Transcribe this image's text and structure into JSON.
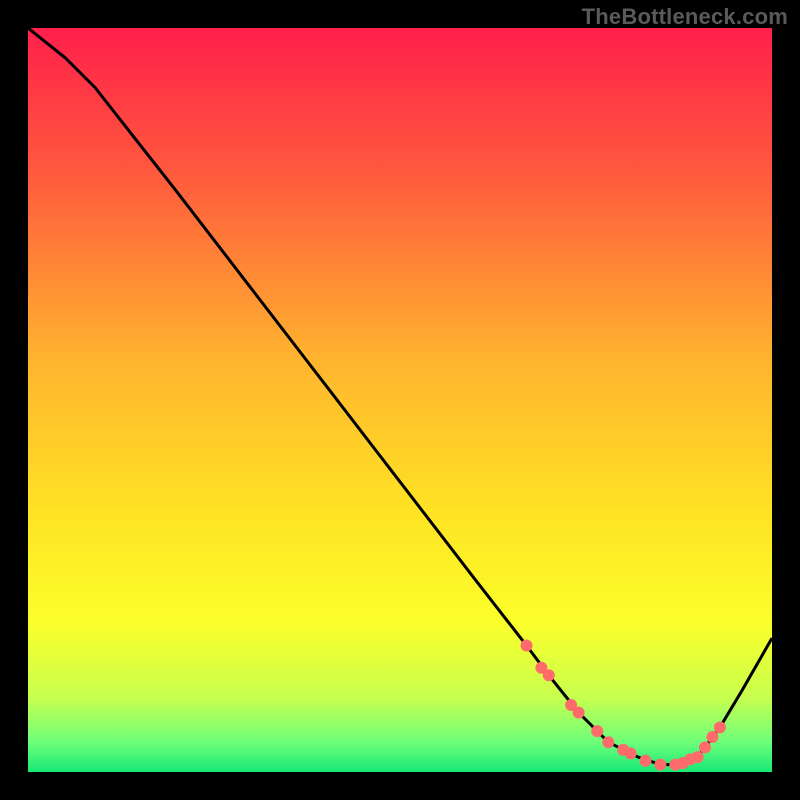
{
  "watermark": "TheBottleneck.com",
  "chart_data": {
    "type": "line",
    "title": "",
    "xlabel": "",
    "ylabel": "",
    "xlim": [
      0,
      100
    ],
    "ylim": [
      0,
      100
    ],
    "grid": false,
    "legend": false,
    "background_gradient": {
      "stops": [
        {
          "offset": 0.0,
          "color": "#ff1f4b"
        },
        {
          "offset": 0.2,
          "color": "#ff5b3d"
        },
        {
          "offset": 0.45,
          "color": "#ffb52e"
        },
        {
          "offset": 0.65,
          "color": "#ffe324"
        },
        {
          "offset": 0.8,
          "color": "#fbff2a"
        },
        {
          "offset": 0.9,
          "color": "#c7ff4e"
        },
        {
          "offset": 0.96,
          "color": "#6dff7a"
        },
        {
          "offset": 1.0,
          "color": "#17e876"
        }
      ]
    },
    "series": [
      {
        "name": "bottleneck-curve",
        "color": "#000000",
        "x": [
          0,
          5,
          9,
          20,
          30,
          40,
          50,
          60,
          67,
          70,
          74,
          78,
          82,
          85,
          88,
          90,
          93,
          96,
          100
        ],
        "y": [
          100,
          96,
          92,
          78,
          65,
          52,
          39,
          26,
          17,
          13,
          8,
          4,
          2,
          1,
          1,
          2,
          6,
          11,
          18
        ]
      }
    ],
    "markers": {
      "name": "highlight-dots",
      "color": "#ff6b6b",
      "radius": 6,
      "points": [
        {
          "x": 67,
          "y": 17
        },
        {
          "x": 69,
          "y": 14
        },
        {
          "x": 70,
          "y": 13
        },
        {
          "x": 73,
          "y": 9
        },
        {
          "x": 74,
          "y": 8
        },
        {
          "x": 76.5,
          "y": 5.5
        },
        {
          "x": 78,
          "y": 4
        },
        {
          "x": 80,
          "y": 3
        },
        {
          "x": 81,
          "y": 2.5
        },
        {
          "x": 83,
          "y": 1.5
        },
        {
          "x": 85,
          "y": 1
        },
        {
          "x": 87,
          "y": 1
        },
        {
          "x": 88,
          "y": 1.2
        },
        {
          "x": 89,
          "y": 1.7
        },
        {
          "x": 90,
          "y": 2
        },
        {
          "x": 91,
          "y": 3.3
        },
        {
          "x": 92,
          "y": 4.7
        },
        {
          "x": 93,
          "y": 6
        }
      ]
    }
  }
}
